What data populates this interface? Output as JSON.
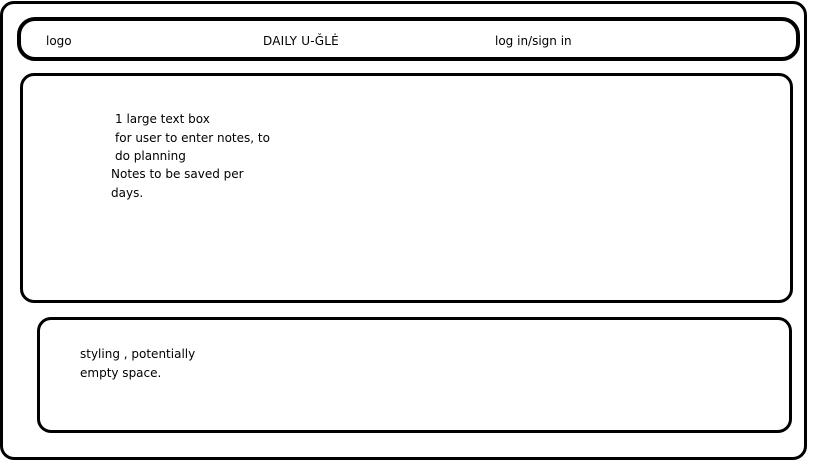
{
  "header": {
    "logo": "logo",
    "title": "DAILY U-ǦLĖ",
    "login": "log in/sign in"
  },
  "notes_box": {
    "lines_a": [
      "1 large text box",
      "for user to enter notes, to",
      "do planning"
    ],
    "lines_b": [
      "Notes to be saved per",
      "days."
    ]
  },
  "footer_box": {
    "lines": [
      "styling , potentially",
      "empty space."
    ]
  }
}
